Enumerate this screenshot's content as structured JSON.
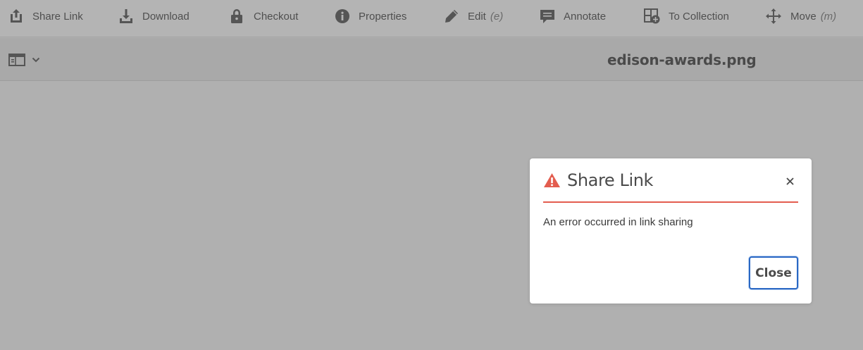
{
  "actionbar": {
    "items": [
      {
        "label": "Share Link",
        "icon": "share-icon"
      },
      {
        "label": "Download",
        "icon": "download-icon"
      },
      {
        "label": "Checkout",
        "icon": "lock-icon"
      },
      {
        "label": "Properties",
        "icon": "info-icon"
      },
      {
        "label": "Edit",
        "shortcut": "(e)",
        "icon": "pencil-icon"
      },
      {
        "label": "Annotate",
        "icon": "comment-icon"
      },
      {
        "label": "To Collection",
        "icon": "add-to-collection-icon"
      },
      {
        "label": "Move",
        "shortcut": "(m)",
        "icon": "move-icon"
      }
    ]
  },
  "titlebar": {
    "rail_toggle_icon": "rail-toggle-icon",
    "file_name": "edison-awards.png"
  },
  "dialog": {
    "title": "Share Link",
    "message": "An error occurred in link sharing",
    "close_button_label": "Close",
    "alert_icon": "alert-icon",
    "accent_color": "#e35d4f",
    "button_border_color": "#2a68c4"
  }
}
